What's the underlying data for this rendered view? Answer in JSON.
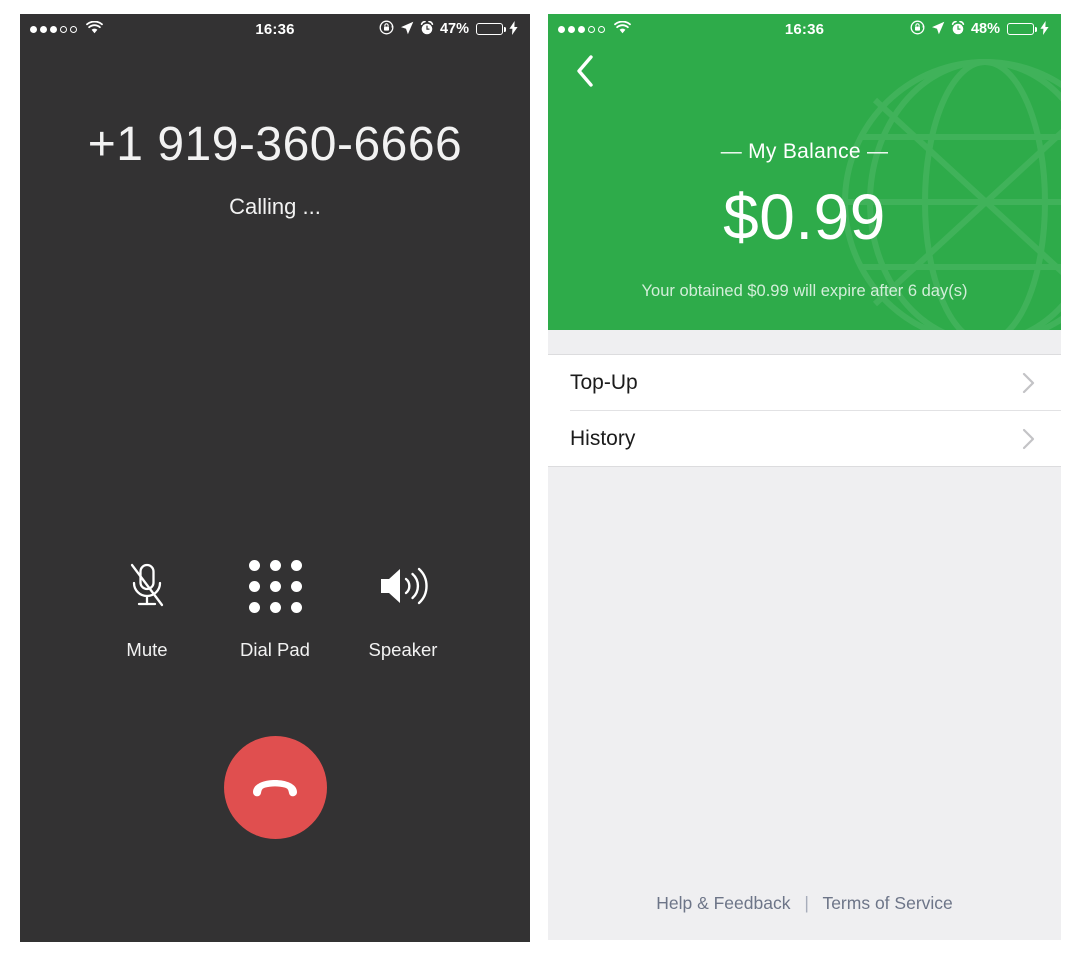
{
  "call_screen": {
    "status_bar": {
      "signal_icon": "signal-dots",
      "signal_dots_filled": 3,
      "signal_dots_total": 5,
      "wifi_icon": "wifi-icon",
      "time": "16:36",
      "rotation_lock_icon": "rotation-lock-icon",
      "location_icon": "location-arrow-icon",
      "alarm_icon": "alarm-clock-icon",
      "battery_percent": "47%",
      "battery_level": 47,
      "battery_icon": "battery-icon",
      "charging_icon": "lightning-bolt-icon"
    },
    "phone_number": "+1 919-360-6666",
    "call_status": "Calling ...",
    "controls": [
      {
        "label": "Mute",
        "icon": "microphone-muted-icon"
      },
      {
        "label": "Dial Pad",
        "icon": "dial-pad-icon"
      },
      {
        "label": "Speaker",
        "icon": "speaker-icon"
      }
    ],
    "end_call": {
      "icon": "hang-up-phone-icon",
      "color": "#e04f4f"
    },
    "background_color": "#333233"
  },
  "wallet_screen": {
    "status_bar": {
      "signal_icon": "signal-dots",
      "signal_dots_filled": 3,
      "signal_dots_total": 5,
      "wifi_icon": "wifi-icon",
      "time": "16:36",
      "rotation_lock_icon": "rotation-lock-icon",
      "location_icon": "location-arrow-icon",
      "alarm_icon": "alarm-clock-icon",
      "battery_percent": "48%",
      "battery_level": 48,
      "battery_icon": "battery-icon",
      "charging_icon": "lightning-bolt-icon"
    },
    "back_icon": "chevron-left-icon",
    "balance_title": "— My Balance —",
    "balance_amount": "$0.99",
    "balance_note": "Your obtained $0.99 will expire after 6 day(s)",
    "header_color": "#2eab4a",
    "watermark_icon": "globe-icon",
    "menu_rows": [
      {
        "label": "Top-Up",
        "chevron": "chevron-right-icon"
      },
      {
        "label": "History",
        "chevron": "chevron-right-icon"
      }
    ],
    "footer": {
      "help_link": "Help & Feedback",
      "separator": "|",
      "terms_link": "Terms of Service",
      "link_color": "#6d7588"
    }
  }
}
